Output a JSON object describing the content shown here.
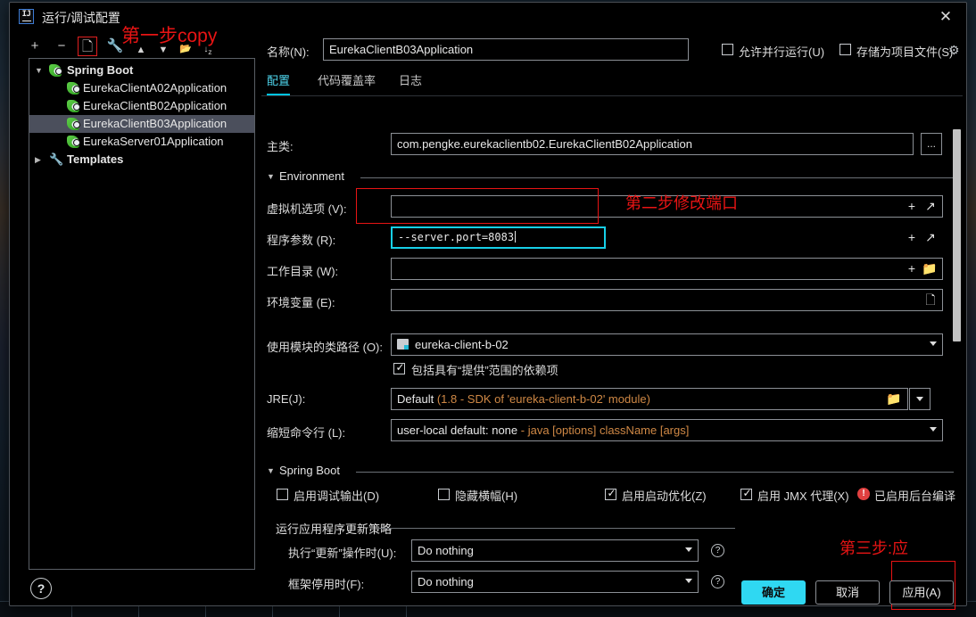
{
  "window": {
    "title": "运行/调试配置",
    "app_icon": "IJ",
    "close_icon": "close-icon"
  },
  "toolbar": {
    "items": [
      {
        "name": "add-configuration",
        "glyph": "+"
      },
      {
        "name": "remove-configuration",
        "glyph": "−"
      },
      {
        "name": "copy-configuration",
        "glyph": "❐",
        "highlighted": true
      },
      {
        "name": "edit-templates",
        "glyph": "🔧"
      },
      {
        "name": "move-up",
        "glyph": "▲"
      },
      {
        "name": "move-down",
        "glyph": "▼"
      },
      {
        "name": "new-folder",
        "glyph": "🗁"
      },
      {
        "name": "sort-configurations",
        "glyph": "↓z"
      }
    ]
  },
  "tree": {
    "root": {
      "label": "Spring Boot",
      "expanded": true
    },
    "children": [
      "EurekaClientA02Application",
      "EurekaClientB02Application",
      "EurekaClientB03Application",
      "EurekaServer01Application"
    ],
    "selected": "EurekaClientB03Application",
    "templates": {
      "label": "Templates",
      "expanded": false
    }
  },
  "header": {
    "name_label": "名称(N):",
    "name_value": "EurekaClientB03Application",
    "allow_parallel_label": "允许并行运行(U)",
    "allow_parallel_checked": false,
    "store_as_project_label": "存储为项目文件(S)",
    "store_as_project_checked": false,
    "gear_icon": "gear-icon"
  },
  "tabs": [
    {
      "label": "配置",
      "active": true
    },
    {
      "label": "代码覆盖率",
      "active": false
    },
    {
      "label": "日志",
      "active": false
    }
  ],
  "form": {
    "main_class": {
      "label": "主类:",
      "value": "com.pengke.eurekaclientb02.EurekaClientB02Application",
      "browse_label": "..."
    },
    "environment_section": "Environment",
    "vm_options": {
      "label": "虚拟机选项 (V):",
      "value": "",
      "icons": [
        "plus-icon",
        "expand-icon"
      ]
    },
    "program_arguments": {
      "label": "程序参数 (R):",
      "value": "--server.port=8083",
      "focused": true,
      "icons": [
        "plus-icon",
        "expand-icon"
      ]
    },
    "working_directory": {
      "label": "工作目录 (W):",
      "value": "",
      "icons": [
        "plus-icon",
        "folder-icon"
      ]
    },
    "environment_variables": {
      "label": "环境变量 (E):",
      "value": "",
      "icons": [
        "list-icon"
      ]
    },
    "module_classpath": {
      "label": "使用模块的类路径 (O):",
      "value": "eureka-client-b-02"
    },
    "include_provided": {
      "label": "包括具有“提供”范围的依赖项",
      "checked": true
    },
    "jre": {
      "label": "JRE(J):",
      "value": "Default",
      "value_sub": "(1.8 - SDK of 'eureka-client-b-02' module)",
      "folder_icon": "folder-icon"
    },
    "shorten_command_line": {
      "label": "缩短命令行 (L):",
      "value": "user-local default: none",
      "value_sub": "- java [options] className [args]"
    }
  },
  "spring_boot": {
    "section": "Spring Boot",
    "checkboxes": [
      {
        "label": "启用调试输出(D)",
        "checked": false
      },
      {
        "label": "隐藏横幅(H)",
        "checked": false
      },
      {
        "label": "启用启动优化(Z)",
        "checked": true
      },
      {
        "label": "启用 JMX 代理(X)",
        "checked": true
      }
    ],
    "warning": {
      "icon": "error-icon",
      "label": "已启用后台编译"
    },
    "update_section": "运行应用程序更新策略",
    "on_update": {
      "label": "执行“更新”操作时(U):",
      "value": "Do nothing",
      "help_icon": "help-icon"
    },
    "on_frame_deactivation": {
      "label": "框架停用时(F):",
      "value": "Do nothing",
      "help_icon": "help-icon"
    }
  },
  "footer": {
    "help_icon": "help-icon",
    "ok_label": "确定",
    "cancel_label": "取消",
    "apply_label": "应用(A)"
  },
  "annotations": [
    {
      "name": "annotation-step-1",
      "text": "第一步copy"
    },
    {
      "name": "annotation-step-2",
      "text": "第二步修改端口"
    },
    {
      "name": "annotation-step-3",
      "text": "第三步:应"
    }
  ],
  "colors": {
    "accent": "#2fd8f2",
    "focus": "#17cfe8",
    "annotation": "#e81414",
    "sub_text": "#cf8845",
    "error": "#e04040"
  }
}
